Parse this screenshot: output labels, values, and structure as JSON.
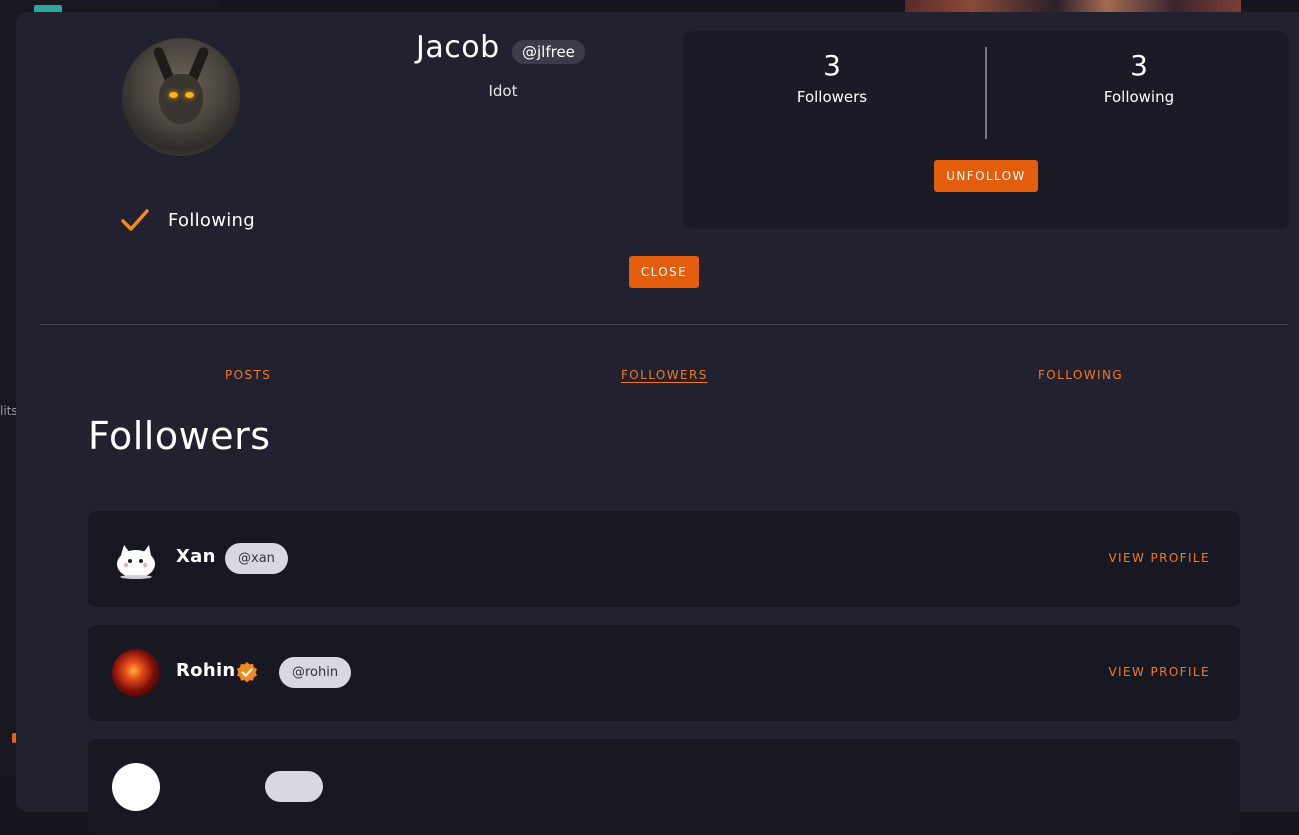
{
  "background": {
    "partial_text": "lits"
  },
  "profile": {
    "name": "Jacob",
    "handle": "@jlfree",
    "bio": "Idot",
    "following_status": "Following",
    "followers_count": "3",
    "followers_label": "Followers",
    "following_count": "3",
    "following_label": "Following",
    "unfollow_label": "UNFOLLOW",
    "close_label": "CLOSE"
  },
  "tabs": [
    {
      "label": "POSTS"
    },
    {
      "label": "FOLLOWERS",
      "active": true
    },
    {
      "label": "FOLLOWING"
    }
  ],
  "section_title": "Followers",
  "followers": [
    {
      "name": "Xan",
      "handle": "@xan",
      "verified": false,
      "action": "VIEW PROFILE",
      "avatar_icon": "white-cat-avatar"
    },
    {
      "name": "Rohin",
      "handle": "@rohin",
      "verified": true,
      "action": "VIEW PROFILE",
      "avatar_icon": "fire-avatar"
    },
    {
      "name": "",
      "handle": "",
      "verified": false,
      "action": "",
      "avatar_icon": "white-avatar"
    }
  ],
  "colors": {
    "accent": "#e35d0c",
    "link": "#f07a28",
    "modal_bg": "#212130",
    "card_bg": "#181822",
    "verified": "#f08a1c"
  }
}
